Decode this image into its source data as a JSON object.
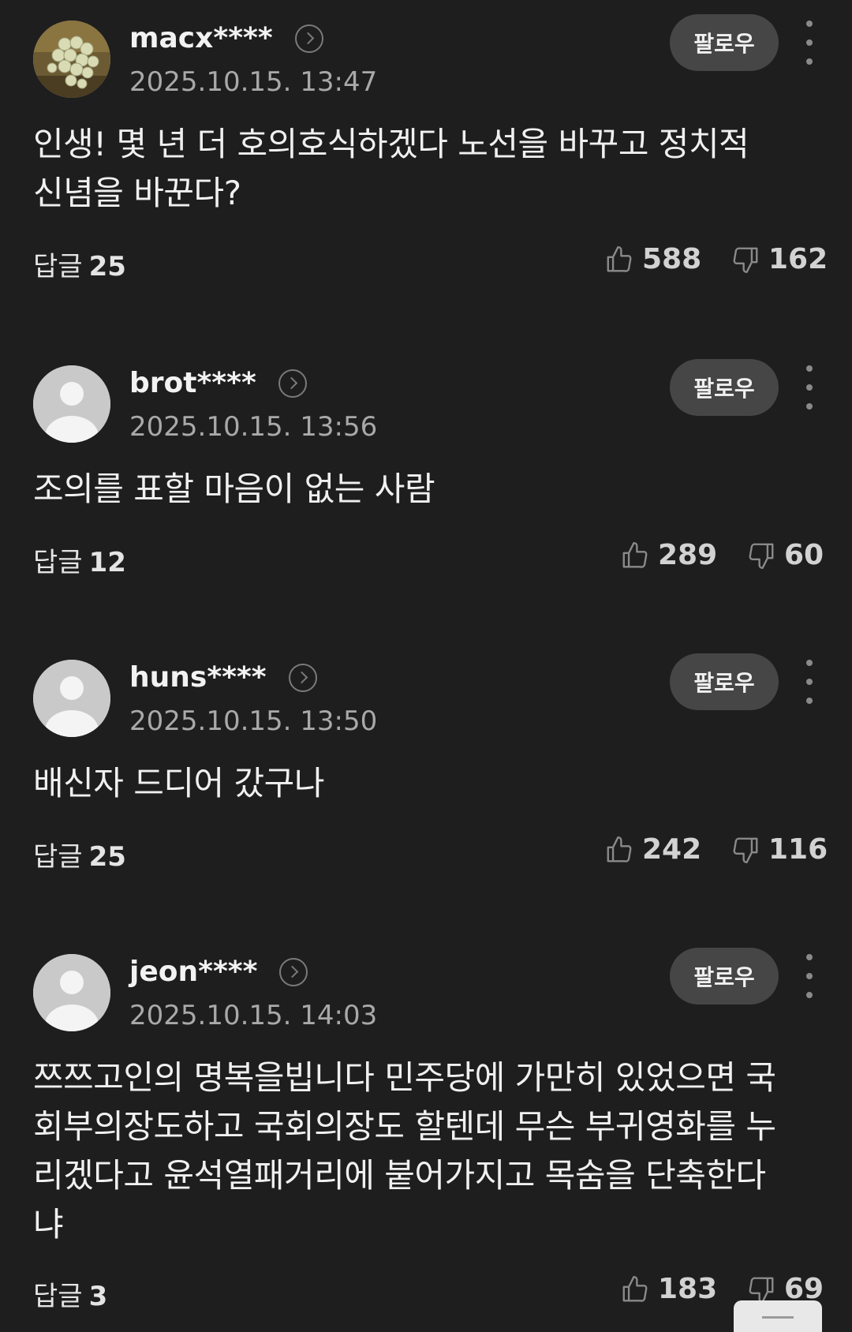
{
  "comments": [
    {
      "username": "macx****",
      "timestamp": "2025.10.15. 13:47",
      "follow_label": "팔로우",
      "content": "인생! 몇 년 더 호의호식하겠다 노선을 바꾸고 정치적 신념을 바꾼다?",
      "reply_label": "답글",
      "reply_count": "25",
      "likes": "588",
      "dislikes": "162",
      "avatar": "grape-photo"
    },
    {
      "username": "brot****",
      "timestamp": "2025.10.15. 13:56",
      "follow_label": "팔로우",
      "content": "조의를 표할 마음이 없는 사람",
      "reply_label": "답글",
      "reply_count": "12",
      "likes": "289",
      "dislikes": "60",
      "avatar": "default-user"
    },
    {
      "username": "huns****",
      "timestamp": "2025.10.15. 13:50",
      "follow_label": "팔로우",
      "content": "배신자 드디어 갔구나",
      "reply_label": "답글",
      "reply_count": "25",
      "likes": "242",
      "dislikes": "116",
      "avatar": "default-user"
    },
    {
      "username": "jeon****",
      "timestamp": "2025.10.15. 14:03",
      "follow_label": "팔로우",
      "content": "쯔쯔고인의 명복을빕니다 민주당에 가만히 있었으면 국회부의장도하고 국회의장도 할텐데 무슨 부귀영화를 누리겠다고 윤석열패거리에 붙어가지고 목숨을 단축한다냐",
      "reply_label": "답글",
      "reply_count": "3",
      "likes": "183",
      "dislikes": "69",
      "avatar": "default-user"
    }
  ],
  "icons": {
    "profile": "chevron-right-circle-icon",
    "more": "kebab-menu-icon",
    "like": "thumbs-up-icon",
    "dislike": "thumbs-down-icon"
  },
  "colors": {
    "background": "#1e1e1e",
    "follow_button": "#464646",
    "text": "#f0f0f0",
    "muted": "#a9a9a9"
  }
}
